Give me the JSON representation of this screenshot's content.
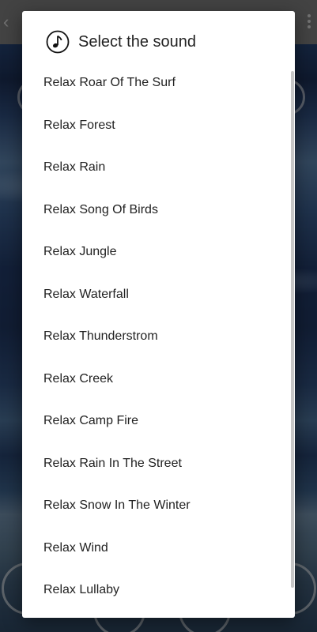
{
  "dialog": {
    "title": "Select the sound",
    "icon": "music-note-icon",
    "items": [
      {
        "label": "Relax Roar Of The Surf"
      },
      {
        "label": "Relax Forest"
      },
      {
        "label": "Relax Rain"
      },
      {
        "label": "Relax Song Of Birds"
      },
      {
        "label": "Relax Jungle"
      },
      {
        "label": "Relax Waterfall"
      },
      {
        "label": "Relax Thunderstrom"
      },
      {
        "label": "Relax Creek"
      },
      {
        "label": "Relax Camp Fire"
      },
      {
        "label": "Relax Rain In The Street"
      },
      {
        "label": "Relax Snow In The Winter"
      },
      {
        "label": "Relax Wind"
      },
      {
        "label": "Relax Lullaby"
      }
    ]
  },
  "colors": {
    "dialog_background": "#ffffff",
    "text": "#222222",
    "scrim": "#000000"
  }
}
